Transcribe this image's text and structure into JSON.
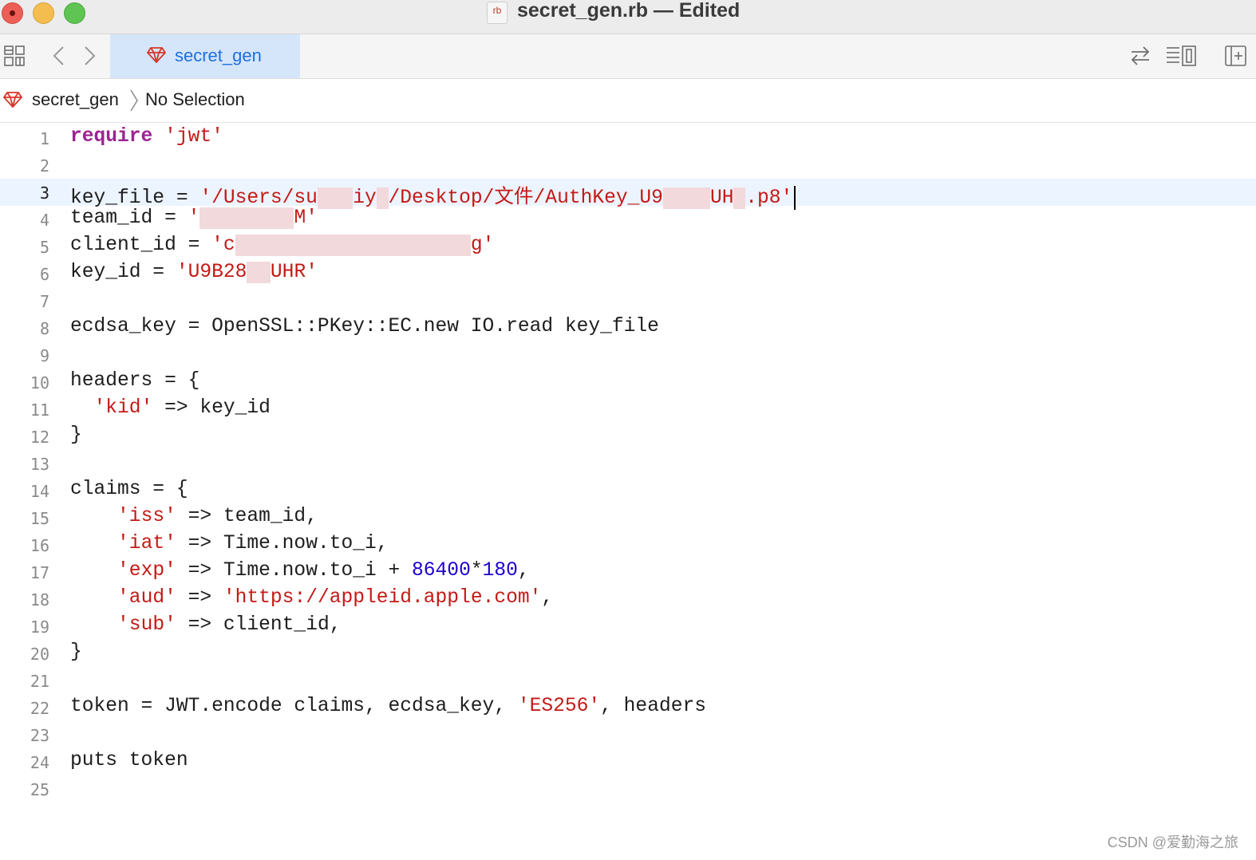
{
  "window": {
    "title": "secret_gen.rb — Edited",
    "doc_icon_label": "rb"
  },
  "tabs": [
    {
      "label": "secret_gen",
      "active": true
    }
  ],
  "jumpbar": {
    "file": "secret_gen",
    "selection": "No Selection"
  },
  "editor": {
    "current_line": 3,
    "lines": [
      {
        "n": "1",
        "tokens": [
          {
            "t": "require",
            "c": "kw"
          },
          {
            "t": " "
          },
          {
            "t": "'jwt'",
            "c": "str"
          }
        ]
      },
      {
        "n": "2",
        "tokens": []
      },
      {
        "n": "3",
        "tokens": [
          {
            "t": "key_file = "
          },
          {
            "t": "'/Users/su",
            "c": "str"
          },
          {
            "t": "███",
            "c": "redact"
          },
          {
            "t": "iy",
            "c": "str"
          },
          {
            "t": "█",
            "c": "redact"
          },
          {
            "t": "/Desktop/文件/AuthKey_U9",
            "c": "str"
          },
          {
            "t": "████",
            "c": "redact"
          },
          {
            "t": "UH",
            "c": "str"
          },
          {
            "t": "█",
            "c": "redact"
          },
          {
            "t": ".p8'",
            "c": "str"
          }
        ],
        "caret": true
      },
      {
        "n": "4",
        "tokens": [
          {
            "t": "team_id = "
          },
          {
            "t": "'",
            "c": "str"
          },
          {
            "t": "████████",
            "c": "redact"
          },
          {
            "t": "M'",
            "c": "str"
          }
        ]
      },
      {
        "n": "5",
        "tokens": [
          {
            "t": "client_id = "
          },
          {
            "t": "'c",
            "c": "str"
          },
          {
            "t": "████████████████████",
            "c": "redact"
          },
          {
            "t": "g'",
            "c": "str"
          }
        ]
      },
      {
        "n": "6",
        "tokens": [
          {
            "t": "key_id = "
          },
          {
            "t": "'U9B28",
            "c": "str"
          },
          {
            "t": "██",
            "c": "redact"
          },
          {
            "t": "UHR'",
            "c": "str"
          }
        ]
      },
      {
        "n": "7",
        "tokens": []
      },
      {
        "n": "8",
        "tokens": [
          {
            "t": "ecdsa_key = OpenSSL::PKey::EC.new IO.read key_file"
          }
        ]
      },
      {
        "n": "9",
        "tokens": []
      },
      {
        "n": "10",
        "tokens": [
          {
            "t": "headers = {"
          }
        ]
      },
      {
        "n": "11",
        "tokens": [
          {
            "t": "  "
          },
          {
            "t": "'kid'",
            "c": "str"
          },
          {
            "t": " => key_id"
          }
        ]
      },
      {
        "n": "12",
        "tokens": [
          {
            "t": "}"
          }
        ]
      },
      {
        "n": "13",
        "tokens": []
      },
      {
        "n": "14",
        "tokens": [
          {
            "t": "claims = {"
          }
        ]
      },
      {
        "n": "15",
        "tokens": [
          {
            "t": "    "
          },
          {
            "t": "'iss'",
            "c": "str"
          },
          {
            "t": " => team_id,"
          }
        ]
      },
      {
        "n": "16",
        "tokens": [
          {
            "t": "    "
          },
          {
            "t": "'iat'",
            "c": "str"
          },
          {
            "t": " => Time.now.to_i,"
          }
        ]
      },
      {
        "n": "17",
        "tokens": [
          {
            "t": "    "
          },
          {
            "t": "'exp'",
            "c": "str"
          },
          {
            "t": " => Time.now.to_i + "
          },
          {
            "t": "86400",
            "c": "num"
          },
          {
            "t": "*"
          },
          {
            "t": "180",
            "c": "num"
          },
          {
            "t": ","
          }
        ]
      },
      {
        "n": "18",
        "tokens": [
          {
            "t": "    "
          },
          {
            "t": "'aud'",
            "c": "str"
          },
          {
            "t": " => "
          },
          {
            "t": "'https://appleid.apple.com'",
            "c": "str"
          },
          {
            "t": ","
          }
        ]
      },
      {
        "n": "19",
        "tokens": [
          {
            "t": "    "
          },
          {
            "t": "'sub'",
            "c": "str"
          },
          {
            "t": " => client_id,"
          }
        ]
      },
      {
        "n": "20",
        "tokens": [
          {
            "t": "}"
          }
        ]
      },
      {
        "n": "21",
        "tokens": []
      },
      {
        "n": "22",
        "tokens": [
          {
            "t": "token = JWT.encode claims, ecdsa_key, "
          },
          {
            "t": "'ES256'",
            "c": "str"
          },
          {
            "t": ", headers"
          }
        ]
      },
      {
        "n": "23",
        "tokens": []
      },
      {
        "n": "24",
        "tokens": [
          {
            "t": "puts token"
          }
        ]
      },
      {
        "n": "25",
        "tokens": []
      }
    ]
  },
  "watermark": "CSDN @爱勤海之旅",
  "colors": {
    "keyword": "#9b2393",
    "string": "#c41a16",
    "number": "#1c00cf",
    "tab_active_bg": "#d5e6fb",
    "current_line_bg": "#ecf4ff"
  },
  "icons": [
    "close-button",
    "minimize-button",
    "zoom-button",
    "ruby-file-icon",
    "grid-icon",
    "back-icon",
    "forward-icon",
    "ruby-gem-icon",
    "swap-arrows-icon",
    "inspector-layout-icon",
    "add-editor-icon",
    "chevron-right-icon"
  ]
}
